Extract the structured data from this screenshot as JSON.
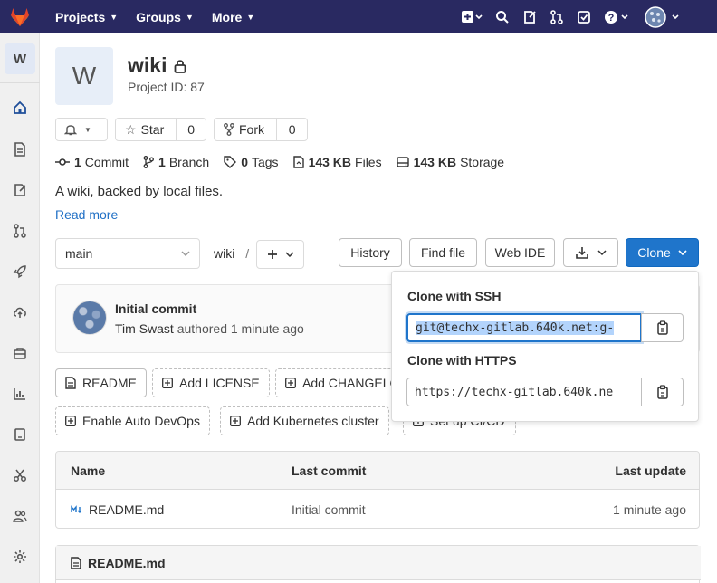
{
  "nav": {
    "items": [
      {
        "label": "Projects"
      },
      {
        "label": "Groups"
      },
      {
        "label": "More"
      }
    ]
  },
  "sidebar": {
    "avatar_letter": "W"
  },
  "project": {
    "avatar_letter": "W",
    "name": "wiki",
    "id_text": "Project ID: 87",
    "star_label": "Star",
    "star_count": "0",
    "fork_label": "Fork",
    "fork_count": "0",
    "description": "A wiki, backed by local files.",
    "read_more": "Read more"
  },
  "stats": {
    "commits_num": "1",
    "commits_label": "Commit",
    "branches_num": "1",
    "branches_label": "Branch",
    "tags_num": "0",
    "tags_label": "Tags",
    "files_size": "143 KB",
    "files_label": "Files",
    "storage_size": "143 KB",
    "storage_label": "Storage"
  },
  "repo": {
    "branch": "main",
    "path": "wiki",
    "path_sep": "/",
    "history": "History",
    "find_file": "Find file",
    "web_ide": "Web IDE",
    "clone": "Clone"
  },
  "commit": {
    "title": "Initial commit",
    "author": "Tim Swast",
    "meta": "authored 1 minute ago"
  },
  "actions": {
    "readme": "README",
    "add_license": "Add LICENSE",
    "add_changelog": "Add CHANGELOG",
    "auto_devops": "Enable Auto DevOps",
    "add_k8s": "Add Kubernetes cluster",
    "setup_cicd": "Set up CI/CD"
  },
  "table": {
    "headers": {
      "name": "Name",
      "last_commit": "Last commit",
      "last_update": "Last update"
    },
    "rows": [
      {
        "name": "README.md",
        "last_commit": "Initial commit",
        "last_update": "1 minute ago"
      }
    ]
  },
  "readme": {
    "title": "README.md"
  },
  "clone_popover": {
    "ssh_label": "Clone with SSH",
    "ssh_url": "git@techx-gitlab.640k.net:g-",
    "https_label": "Clone with HTTPS",
    "https_url": "https://techx-gitlab.640k.ne"
  }
}
